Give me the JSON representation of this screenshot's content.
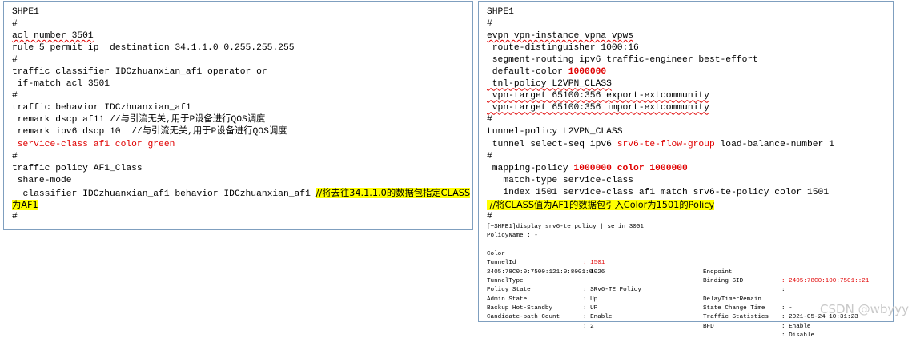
{
  "left": {
    "lines": [
      "SHPE1",
      "#",
      "acl number 3501",
      "rule 5 permit ip  destination 34.1.1.0 0.255.255.255",
      "#",
      "traffic classifier IDCzhuanxian_af1 operator or",
      " if-match acl 3501",
      "#",
      "traffic behavior IDCzhuanxian_af1",
      " remark dscp af11 //与引流无关,用于P设备进行QOS调度",
      " remark ipv6 dscp 10  //与引流无关,用于P设备进行QOS调度",
      " service-class af1 color green",
      "#",
      "traffic policy AF1_Class",
      " share-mode",
      "  classifier IDCzhuanxian_af1 behavior IDCzhuanxian_af1 ",
      "//将去往34.1.1.0的数据包指定CLASS",
      "为AF1",
      "#"
    ]
  },
  "right": {
    "lines": [
      "SHPE1",
      "#",
      "evpn vpn-instance vpna vpws",
      " route-distinguisher 1000:16",
      " segment-routing ipv6 traffic-engineer best-effort",
      " default-color ",
      "1000000",
      " tnl-policy L2VPN_CLASS",
      " vpn-target 65100:356 export-extcommunity",
      " vpn-target 65100:356 import-extcommunity",
      "#",
      "tunnel-policy L2VPN_CLASS",
      " tunnel select-seq ipv6 ",
      "srv6-te-flow-group",
      " load-balance-number 1",
      "#",
      " mapping-policy ",
      "1000000 color 1000000",
      "   match-type service-class",
      "   index 1501 service-class af1 match srv6-te-policy color 1501",
      " //将CLASS值为AF1的数据包引入Color为1501的Policy",
      "#"
    ],
    "terminal": {
      "prompt": "[~SHPE1]display srv6-te policy | se in 3001",
      "policy_name": "PolicyName : -",
      "rows": [
        [
          "Color",
          ": 1501",
          "Endpoint",
          ": 2405:78C0:100:7501::21"
        ],
        [
          "TunnelId",
          ": 1026",
          "Binding SID",
          ":"
        ],
        [
          "2405:78C0:0:7500:121:0:8001:0",
          "",
          "",
          ""
        ],
        [
          "TunnelType",
          ": SRv6-TE Policy",
          "DelayTimerRemain",
          ": -"
        ],
        [
          "Policy State",
          ": Up",
          "State Change Time",
          ": 2021-05-24 10:31:23"
        ],
        [
          "Admin State",
          ": UP",
          "Traffic Statistics",
          ": Enable"
        ],
        [
          "Backup Hot-Standby",
          ": Enable",
          "BFD",
          ": Disable"
        ],
        [
          "Candidate-path Count",
          ": 2",
          "",
          ""
        ]
      ]
    }
  },
  "watermark": "CSDN @wbyyy",
  "colors": {
    "red": "#e00000",
    "highlight": "#ffff00",
    "border": "#7f9fbf"
  }
}
